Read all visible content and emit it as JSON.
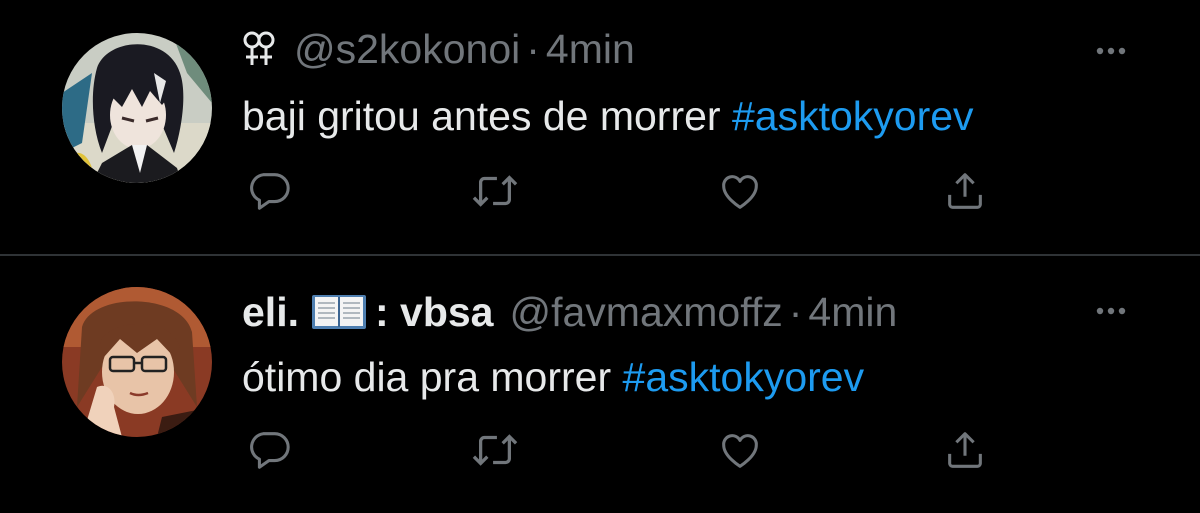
{
  "colors": {
    "background": "#000000",
    "text": "#e7e9ea",
    "secondary": "#71767b",
    "link": "#1d9bf0",
    "divider": "#2f3336"
  },
  "tweets": [
    {
      "display_name": "",
      "name_icon": "venus-symbol-icon",
      "handle": "@s2kokonoi",
      "separator": "·",
      "time": "4min",
      "text": "baji gritou antes de morrer ",
      "hashtag": "#asktokyorev",
      "avatar_icon": "anime-avatar-dark-hair"
    },
    {
      "display_name_prefix": "eli.",
      "name_icon": "open-book-emoji-icon",
      "display_name_suffix": ": vbsa",
      "handle": "@favmaxmoffz",
      "separator": "·",
      "time": "4min",
      "text": "ótimo dia pra morrer ",
      "hashtag": "#asktokyorev",
      "avatar_icon": "anime-avatar-glasses"
    }
  ],
  "actions": [
    "reply-icon",
    "retweet-icon",
    "like-icon",
    "share-icon"
  ]
}
